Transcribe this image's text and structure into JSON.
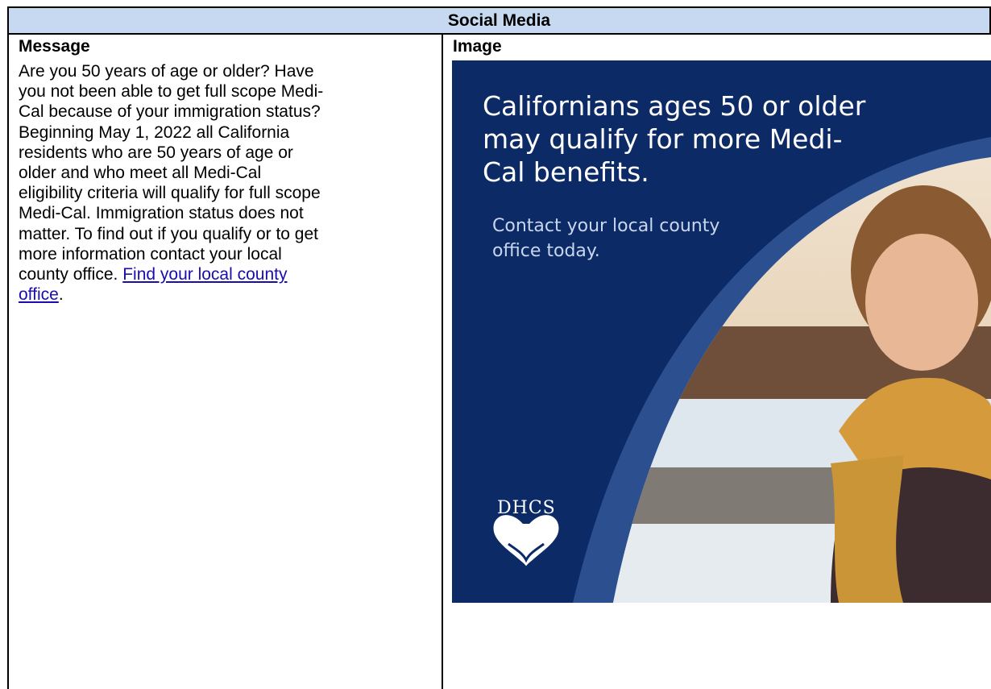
{
  "table": {
    "title": "Social Media",
    "col_message": "Message",
    "col_image": "Image"
  },
  "message": {
    "body": "Are you 50 years of age or older? Have you not been able to get full scope Medi-Cal because of your immigration status? Beginning May 1, 2022 all California residents who are 50 years of age or older and who meet all Medi-Cal eligibility criteria will qualify for full scope Medi-Cal. Immigration status does not matter. To find out if you qualify or to get more information contact your local county office. ",
    "link_text": "Find your local county office",
    "after_link": "."
  },
  "promo": {
    "headline": "Californians ages 50 or older may qualify for more Medi-Cal benefits.",
    "subtext": "Contact your local county office today.",
    "logo": "DHCS",
    "colors": {
      "navy": "#0c2a66",
      "mid_blue": "#2c4f8f"
    }
  }
}
